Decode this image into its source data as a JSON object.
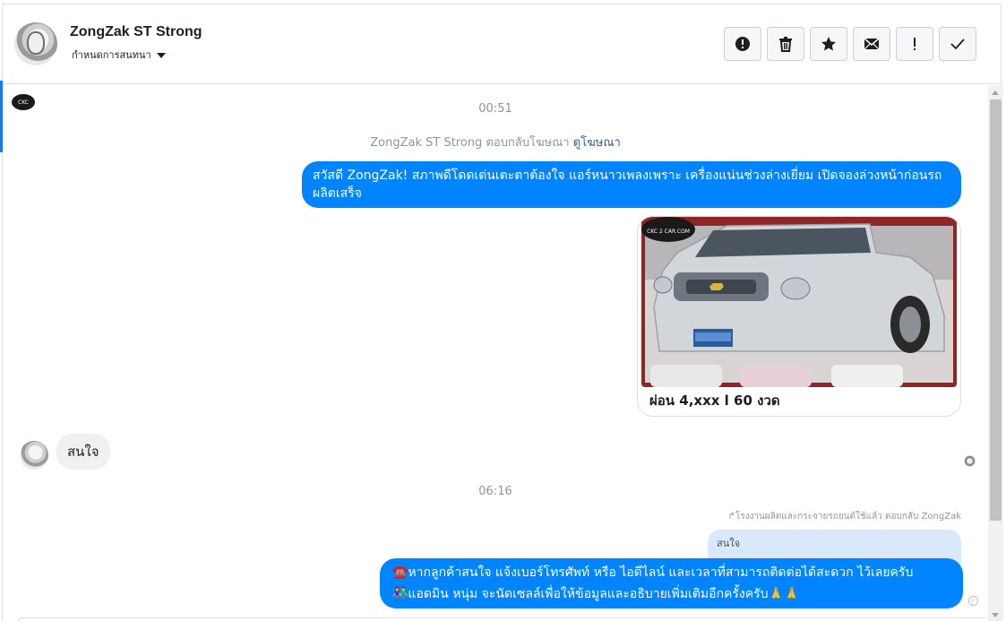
{
  "header": {
    "contact_name": "ZongZak ST Strong",
    "assign_label": "กำหนดการสนทนา",
    "toolbar": [
      {
        "name": "report-spam-button",
        "icon": "alert-circle-icon"
      },
      {
        "name": "delete-button",
        "icon": "trash-icon"
      },
      {
        "name": "star-button",
        "icon": "star-icon"
      },
      {
        "name": "mark-unread-button",
        "icon": "envelope-icon"
      },
      {
        "name": "follow-up-button",
        "icon": "exclamation-icon"
      },
      {
        "name": "mark-done-button",
        "icon": "check-icon"
      }
    ]
  },
  "conversation": {
    "page_logo_text": "CKC",
    "timestamp_1": "00:51",
    "ad_reply_note": "ZongZak ST Strong ตอบกลับโฆษณา",
    "ad_reply_link": "ดูโฆษณา",
    "message_1": "สวัสดี ZongZak! สภาพดีโดดเด่นเตะตาต้องใจ แอร์หนาวเพลงเพราะ เครื่องแน่นช่วงล่างเยี่ยม เปิดจองล่วงหน้าก่อนรถผลิตเสร็จ",
    "ad_watermark": "CKC 2 CAR.COM",
    "ad_caption": "ผ่อน 4,xxx l 60 งวด",
    "customer_message": "สนใจ",
    "timestamp_2": "06:16",
    "quote_meta": "↱โรงงานผลิตและกระจายรถยนต์ใช้แล้ว ตอบกลับ ZongZak",
    "quoted_text": "สนใจ",
    "message_final_line_1": "☎️หากลูกค้าสนใจ แจ้งเบอร์โทรศัพท์ หรือ ไอดีไลน์ และเวลาที่สามารถติดต่อได้สะดวก ไว้เลยครับ",
    "message_final_line_2": "👫แอดมิน หนุ่ม จะนัดเซลล์เพื่อให้ข้อมูลและอธิบายเพิ่มเติมอีกครั้งครับ🙏🙏",
    "seen_mark": "✓"
  },
  "colors": {
    "outgoing_bubble": "#0084ff",
    "incoming_bubble": "#f1f0f0",
    "quoted_bubble": "#d9e8fb",
    "link": "#365899",
    "meta_text": "#90949c"
  }
}
